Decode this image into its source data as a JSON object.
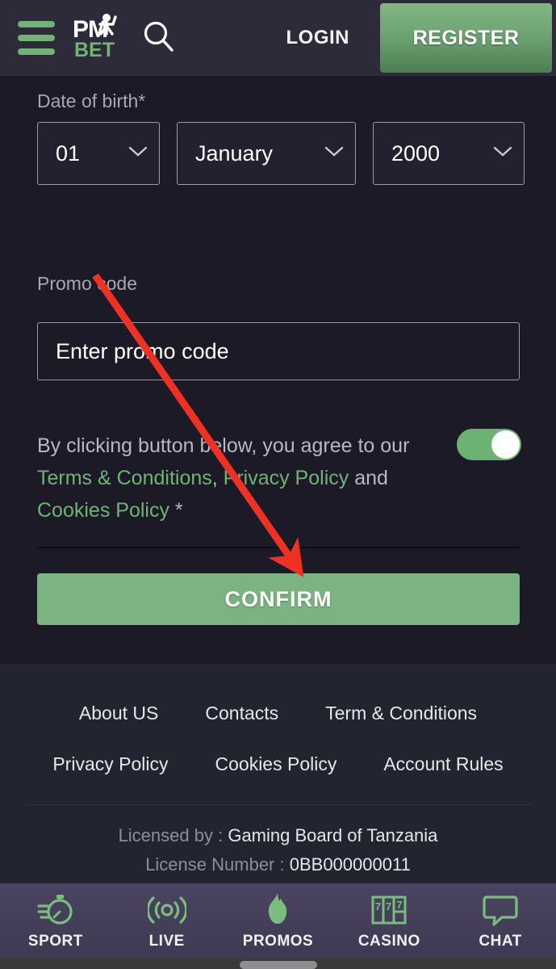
{
  "header": {
    "menu_icon": "hamburger-menu-icon",
    "logo_primary": "PM",
    "logo_secondary": "BET",
    "search_icon": "search-icon",
    "login_label": "LOGIN",
    "register_label": "REGISTER"
  },
  "form": {
    "dob_label": "Date of birth*",
    "dob_day": "01",
    "dob_month": "January",
    "dob_year": "2000",
    "chevron_icon": "chevron-down-icon",
    "promo_label": "Promo code",
    "promo_value": "",
    "promo_placeholder": "Enter promo code",
    "terms_prefix": "By clicking button below, you agree to our",
    "terms_link_1": "Terms & Conditions",
    "terms_separator": ",",
    "terms_link_2": "Privacy Policy",
    "terms_conjunction": "and",
    "terms_link_3": "Cookies Policy",
    "terms_required": "*",
    "terms_toggle_state": "on",
    "confirm_label": "CONFIRM"
  },
  "footer": {
    "links_row_1": [
      "About US",
      "Contacts",
      "Term & Conditions"
    ],
    "links_row_2": [
      "Privacy Policy",
      "Cookies Policy",
      "Account Rules"
    ],
    "license_label": "Licensed by :",
    "license_value": "Gaming Board of Tanzania",
    "license_number_label": "License Number :",
    "license_number_value": "0BB000000011"
  },
  "bottom_nav": [
    {
      "label": "SPORT",
      "icon": "stopwatch-icon"
    },
    {
      "label": "LIVE",
      "icon": "live-broadcast-icon"
    },
    {
      "label": "PROMOS",
      "icon": "flame-icon"
    },
    {
      "label": "CASINO",
      "icon": "slot-machine-777-icon"
    },
    {
      "label": "CHAT",
      "icon": "chat-bubble-icon"
    }
  ],
  "colors": {
    "accent_green": "#6fb474",
    "button_green": "#7cb382",
    "background": "#1c1a27",
    "footer_background": "#22252f",
    "nav_background": "#443f59",
    "annotation_red": "#ef3124"
  },
  "annotation": {
    "type": "arrow",
    "from": "Promo code label",
    "to": "CONFIRM button"
  }
}
